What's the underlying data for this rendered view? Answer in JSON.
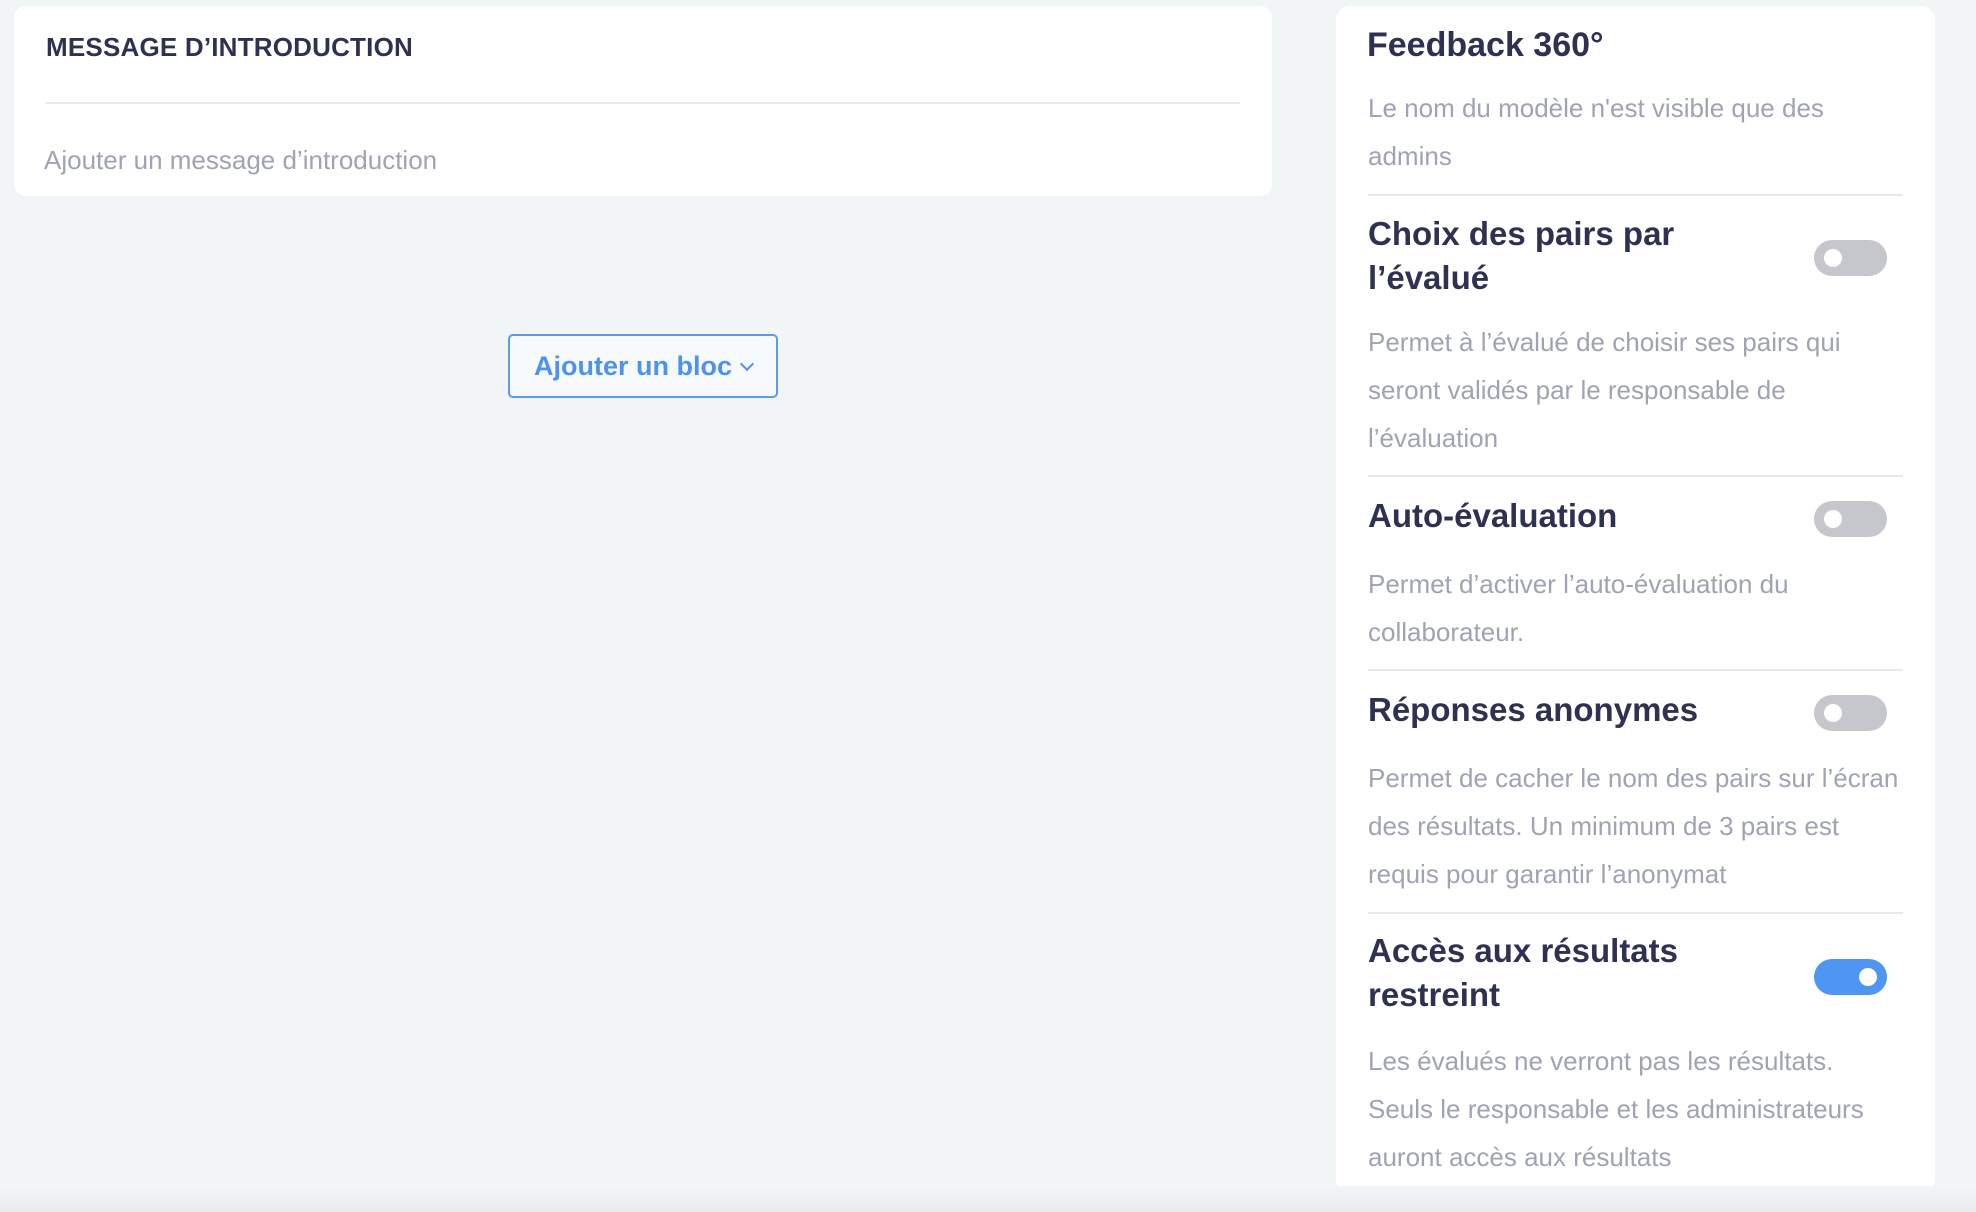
{
  "intro": {
    "title": "MESSAGE D’INTRODUCTION",
    "placeholder": "Ajouter un message d’introduction"
  },
  "add_block": {
    "label": "Ajouter un bloc",
    "icon": "chevron-down-icon"
  },
  "settings": {
    "title": "Feedback 360°",
    "subtitle": "Le nom du modèle n'est visible que des admins",
    "options": [
      {
        "title": "Choix des pairs par l’évalué",
        "description": "Permet à l’évalué de choisir ses pairs qui seront validés par le responsable de l’évaluation",
        "enabled": false
      },
      {
        "title": "Auto-évaluation",
        "description": "Permet d’activer l’auto-évaluation du collaborateur.",
        "enabled": false
      },
      {
        "title": "Réponses anonymes",
        "description": "Permet de cacher le nom des pairs sur l’écran des résultats. Un minimum de 3 pairs est requis pour garantir l’anonymat",
        "enabled": false
      },
      {
        "title": "Accès aux résultats restreint",
        "description": "Les évalués ne verront pas les résultats. Seuls le responsable et les administrateurs auront accès aux résultats",
        "enabled": true
      }
    ]
  },
  "colors": {
    "accent": "#4f96f2",
    "toggle_off": "#c6c7cc",
    "heading": "#2f3152",
    "muted": "#9fa3b4",
    "background": "#f2f5f6"
  }
}
